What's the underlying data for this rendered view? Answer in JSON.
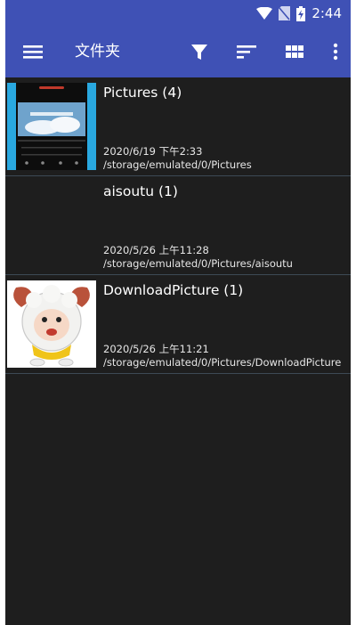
{
  "status_bar": {
    "time": "2:44"
  },
  "toolbar": {
    "title": "文件夹",
    "menu_icon": "hamburger-menu-icon",
    "filter_icon": "filter-icon",
    "sort_icon": "sort-icon",
    "grid_icon": "grid-view-icon",
    "more_icon": "more-vert-icon"
  },
  "folders": [
    {
      "title": "Pictures (4)",
      "date": "2020/6/19 下午2:33",
      "path": "/storage/emulated/0/Pictures",
      "thumb": "phone-screenshot"
    },
    {
      "title": "aisoutu (1)",
      "date": "2020/5/26 上午11:28",
      "path": "/storage/emulated/0/Pictures/aisoutu",
      "thumb": "none"
    },
    {
      "title": "DownloadPicture (1)",
      "date": "2020/5/26 上午11:21",
      "path": "/storage/emulated/0/Pictures/DownloadPicture",
      "thumb": "cartoon-lamb"
    }
  ],
  "colors": {
    "primary": "#3f51b5",
    "background": "#1e1e1e",
    "divider": "#3d4a55",
    "thumb_accent": "#29a8e0"
  }
}
